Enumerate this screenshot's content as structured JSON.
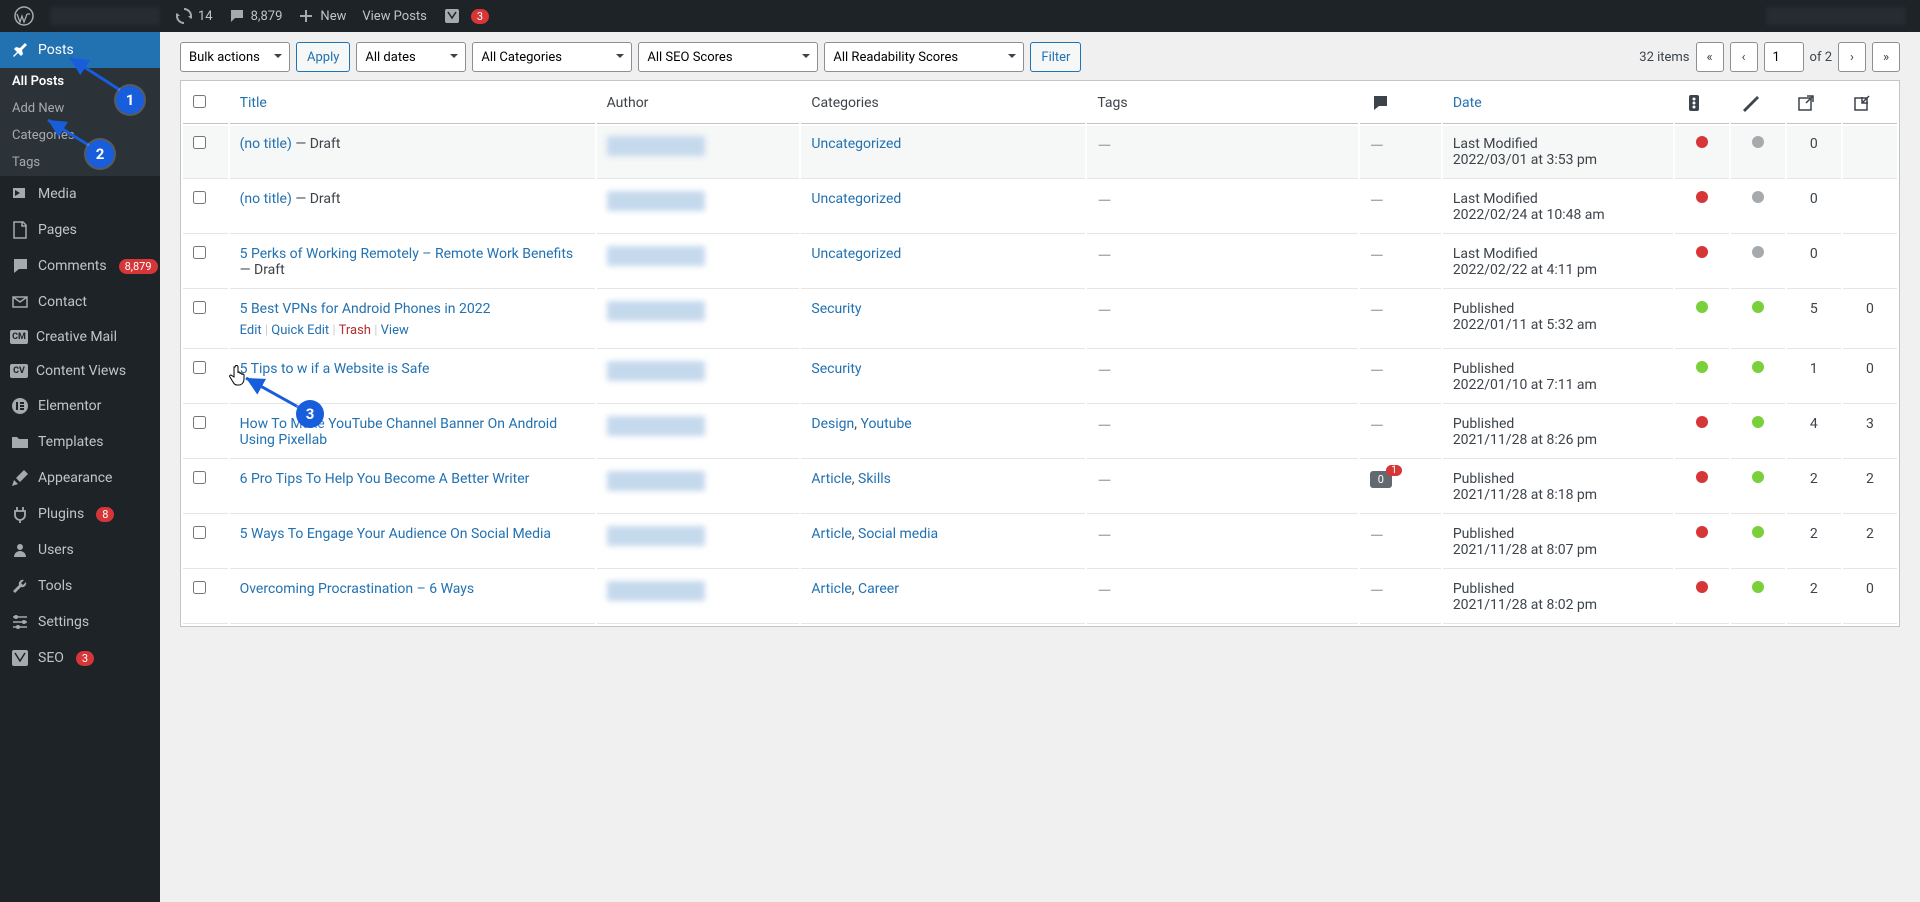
{
  "adminbar": {
    "updates_count": "14",
    "comments_count": "8,879",
    "new": "New",
    "view_posts": "View Posts",
    "yoast_badge": "3"
  },
  "sidebar": {
    "posts": "Posts",
    "subs": {
      "all": "All Posts",
      "add": "Add New",
      "categories": "Categories",
      "tags": "Tags"
    },
    "media": "Media",
    "pages": "Pages",
    "comments": "Comments",
    "comments_badge": "8,879",
    "contact": "Contact",
    "creative_mail": "Creative Mail",
    "content_views": "Content Views",
    "elementor": "Elementor",
    "templates": "Templates",
    "appearance": "Appearance",
    "plugins": "Plugins",
    "plugins_badge": "8",
    "users": "Users",
    "tools": "Tools",
    "settings": "Settings",
    "seo": "SEO",
    "seo_badge": "3"
  },
  "filters": {
    "bulk": "Bulk actions",
    "apply": "Apply",
    "all_dates": "All dates",
    "all_categories": "All Categories",
    "all_seo": "All SEO Scores",
    "all_readability": "All Readability Scores",
    "filter": "Filter",
    "items": "32 items",
    "page": "1",
    "of": "of 2"
  },
  "columns": {
    "title": "Title",
    "author": "Author",
    "categories": "Categories",
    "tags": "Tags",
    "date": "Date"
  },
  "row_actions": {
    "edit": "Edit",
    "quick": "Quick Edit",
    "trash": "Trash",
    "view": "View"
  },
  "posts": [
    {
      "title": "(no title)",
      "status": " — Draft",
      "cats": [
        {
          "t": "Uncategorized"
        }
      ],
      "tags": "—",
      "com": null,
      "date_label": "Last Modified",
      "date_when": "2022/03/01 at 3:53 pm",
      "dot1": "red",
      "dot2": "grey",
      "n1": "0",
      "n2": ""
    },
    {
      "title": "(no title)",
      "status": " — Draft",
      "cats": [
        {
          "t": "Uncategorized"
        }
      ],
      "tags": "—",
      "com": null,
      "date_label": "Last Modified",
      "date_when": "2022/02/24 at 10:48 am",
      "dot1": "red",
      "dot2": "grey",
      "n1": "0",
      "n2": ""
    },
    {
      "title": "5 Perks of Working Remotely – Remote Work Benefits",
      "status": " — Draft",
      "cats": [
        {
          "t": "Uncategorized"
        }
      ],
      "tags": "—",
      "com": null,
      "date_label": "Last Modified",
      "date_when": "2022/02/22 at 4:11 pm",
      "dot1": "red",
      "dot2": "grey",
      "n1": "0",
      "n2": ""
    },
    {
      "title": "5 Best VPNs for Android Phones in 2022",
      "status": "",
      "cats": [
        {
          "t": "Security"
        }
      ],
      "tags": "—",
      "com": null,
      "date_label": "Published",
      "date_when": "2022/01/11 at 5:32 am",
      "dot1": "green",
      "dot2": "green",
      "n1": "5",
      "n2": "0",
      "show_actions": true
    },
    {
      "title": "5 Tips to          w if a Website is Safe",
      "status": "",
      "cats": [
        {
          "t": "Security"
        }
      ],
      "tags": "—",
      "com": null,
      "date_label": "Published",
      "date_when": "2022/01/10 at 7:11 am",
      "dot1": "green",
      "dot2": "green",
      "n1": "1",
      "n2": "0"
    },
    {
      "title": "How To Make YouTube Channel Banner On Android Using Pixellab",
      "status": "",
      "cats": [
        {
          "t": "Design"
        },
        {
          "t": "Youtube"
        }
      ],
      "tags": "—",
      "com": null,
      "date_label": "Published",
      "date_when": "2021/11/28 at 8:26 pm",
      "dot1": "red",
      "dot2": "green",
      "n1": "4",
      "n2": "3"
    },
    {
      "title": "6 Pro Tips To Help You Become A Better Writer",
      "status": "",
      "cats": [
        {
          "t": "Article"
        },
        {
          "t": "Skills"
        }
      ],
      "tags": "—",
      "com": {
        "c": "0",
        "p": "1"
      },
      "date_label": "Published",
      "date_when": "2021/11/28 at 8:18 pm",
      "dot1": "red",
      "dot2": "green",
      "n1": "2",
      "n2": "2"
    },
    {
      "title": "5 Ways To Engage Your Audience On Social Media",
      "status": "",
      "cats": [
        {
          "t": "Article"
        },
        {
          "t": "Social media"
        }
      ],
      "tags": "—",
      "com": null,
      "date_label": "Published",
      "date_when": "2021/11/28 at 8:07 pm",
      "dot1": "red",
      "dot2": "green",
      "n1": "2",
      "n2": "2"
    },
    {
      "title": "Overcoming Procrastination – 6 Ways",
      "status": "",
      "cats": [
        {
          "t": "Article"
        },
        {
          "t": "Career"
        }
      ],
      "tags": "—",
      "com": null,
      "date_label": "Published",
      "date_when": "2021/11/28 at 8:02 pm",
      "dot1": "red",
      "dot2": "green",
      "n1": "2",
      "n2": "0"
    }
  ],
  "annotations": {
    "a1": "1",
    "a2": "2",
    "a3": "3"
  }
}
